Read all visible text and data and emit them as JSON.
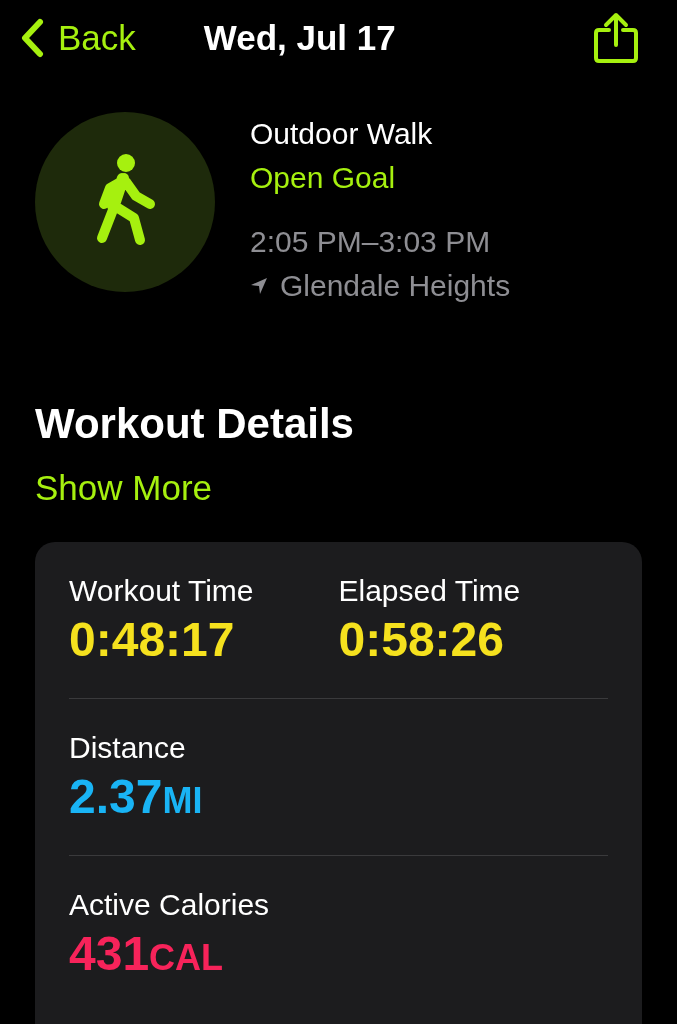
{
  "header": {
    "back": "Back",
    "title": "Wed, Jul 17"
  },
  "workout": {
    "name": "Outdoor Walk",
    "goal": "Open Goal",
    "time": "2:05 PM–3:03 PM",
    "location": "Glendale Heights"
  },
  "section": {
    "title": "Workout Details",
    "show_more": "Show More"
  },
  "metric_rows": [
    [
      {
        "label": "Workout Time",
        "value": "0:48:17",
        "color": "#f5e11e"
      },
      {
        "label": "Elapsed Time",
        "value": "0:58:26",
        "color": "#f5e11e"
      }
    ],
    [
      {
        "label": "Distance",
        "value": "2.37",
        "unit": "MI",
        "color": "#19b4f5"
      }
    ],
    [
      {
        "label": "Active Calories",
        "value": "431",
        "unit": "CAL",
        "color": "#f7235a"
      }
    ]
  ]
}
